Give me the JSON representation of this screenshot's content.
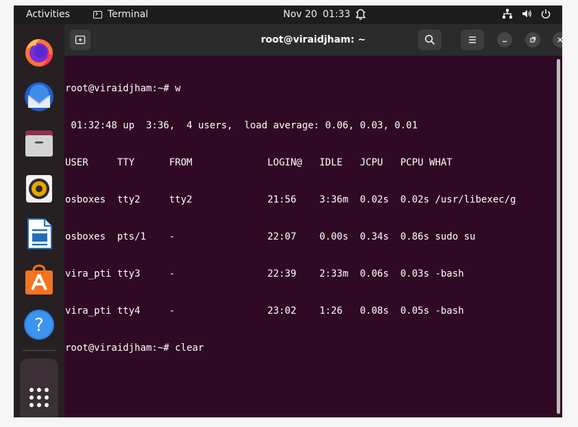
{
  "topbar": {
    "activities": "Activities",
    "app_name": "Terminal",
    "date": "Nov 20",
    "time": "01:33",
    "icons": [
      "bell-icon",
      "network-icon",
      "volume-icon",
      "power-icon"
    ]
  },
  "dock": {
    "items": [
      "firefox",
      "thunderbird",
      "files",
      "rhythmbox",
      "libreoffice-writer",
      "ubuntu-software",
      "help"
    ],
    "show_apps": "show-applications"
  },
  "terminal": {
    "title": "root@viraidjham: ~",
    "background": "#300a24",
    "lines": [
      "root@viraidjham:~# w",
      " 01:32:48 up  3:36,  4 users,  load average: 0.06, 0.03, 0.01",
      "USER     TTY      FROM             LOGIN@   IDLE   JCPU   PCPU WHAT",
      "osboxes  tty2     tty2             21:56    3:36m  0.02s  0.02s /usr/libexec/g",
      "osboxes  pts/1    -                22:07    0.00s  0.34s  0.86s sudo su",
      "vira_pti tty3     -                22:39    2:33m  0.06s  0.03s -bash",
      "vira_pti tty4     -                23:02    1:26   0.08s  0.05s -bash",
      "root@viraidjham:~# clear"
    ]
  }
}
